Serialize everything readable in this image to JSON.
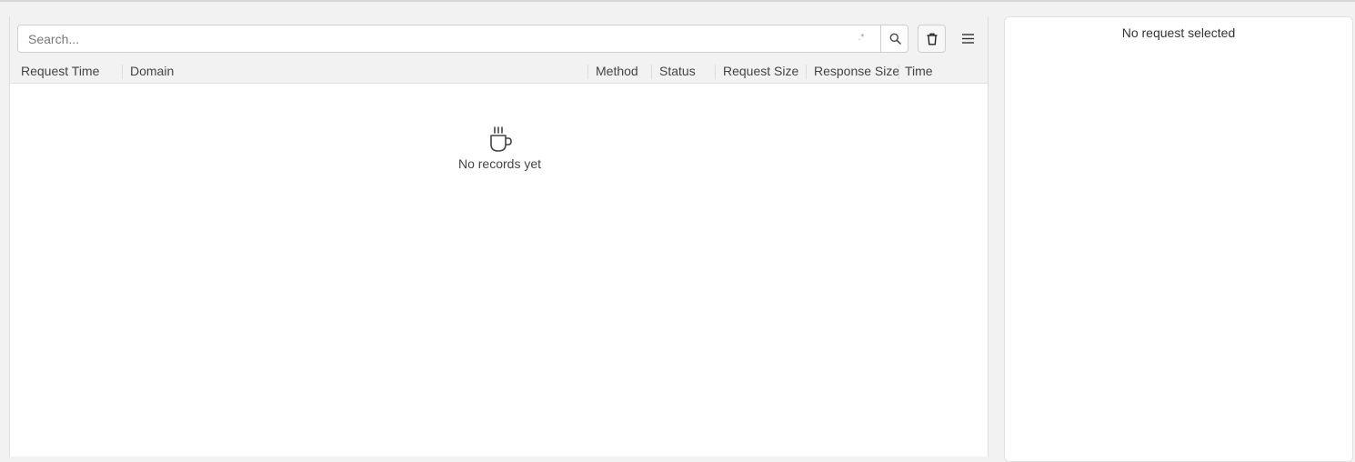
{
  "toolbar": {
    "search_placeholder": "Search...",
    "regex_symbol": ".*",
    "search_icon": "search-icon",
    "clear_icon": "trash-icon",
    "menu_icon": "hamburger-menu-icon"
  },
  "table": {
    "columns": [
      "Request Time",
      "Domain",
      "Method",
      "Status",
      "Request Size",
      "Response Size",
      "Time"
    ]
  },
  "empty_state": {
    "icon": "coffee-cup-icon",
    "message": "No records yet"
  },
  "detail_panel": {
    "message": "No request selected"
  }
}
